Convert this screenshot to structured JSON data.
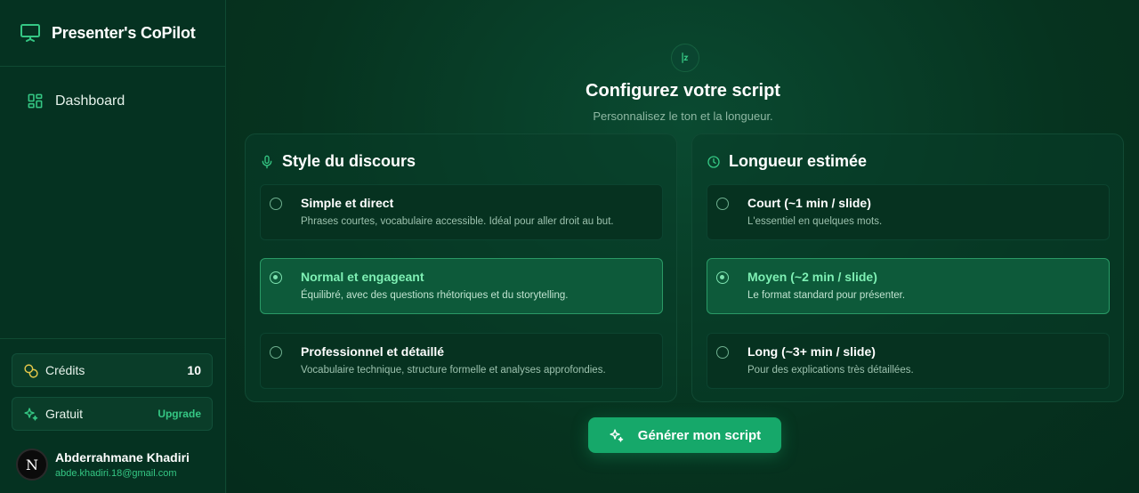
{
  "app": {
    "title": "Presenter's CoPilot"
  },
  "sidebar": {
    "nav": [
      {
        "label": "Dashboard",
        "icon": "dashboard-grid-icon"
      }
    ],
    "credits": {
      "label": "Crédits",
      "count": "10",
      "icon": "coins-icon"
    },
    "plan": {
      "label": "Gratuit",
      "action": "Upgrade",
      "icon": "sparkles-icon"
    },
    "user": {
      "initial": "N",
      "name": "Abderrahmane Khadiri",
      "email": "abde.khadiri.18@gmail.com"
    }
  },
  "main": {
    "title": "Configurez votre script",
    "subtitle": "Personnalisez le ton et la longueur.",
    "style_panel": {
      "title": "Style du discours",
      "icon": "microphone-icon",
      "options": [
        {
          "title": "Simple et direct",
          "desc": "Phrases courtes, vocabulaire accessible. Idéal pour aller droit au but.",
          "selected": false
        },
        {
          "title": "Normal et engageant",
          "desc": "Équilibré, avec des questions rhétoriques et du storytelling.",
          "selected": true
        },
        {
          "title": "Professionnel et détaillé",
          "desc": "Vocabulaire technique, structure formelle et analyses approfondies.",
          "selected": false
        }
      ]
    },
    "length_panel": {
      "title": "Longueur estimée",
      "icon": "clock-icon",
      "options": [
        {
          "title": "Court (~1 min / slide)",
          "desc": "L'essentiel en quelques mots.",
          "selected": false
        },
        {
          "title": "Moyen (~2 min / slide)",
          "desc": "Le format standard pour présenter.",
          "selected": true
        },
        {
          "title": "Long (~3+ min / slide)",
          "desc": "Pour des explications très détaillées.",
          "selected": false
        }
      ]
    },
    "generate_button": {
      "label": "Générer mon script",
      "icon": "sparkles-icon"
    }
  },
  "colors": {
    "background": "#06301f",
    "accent": "#16a86a",
    "accent_text": "#7ef0b4",
    "muted": "#8fb8a3"
  }
}
